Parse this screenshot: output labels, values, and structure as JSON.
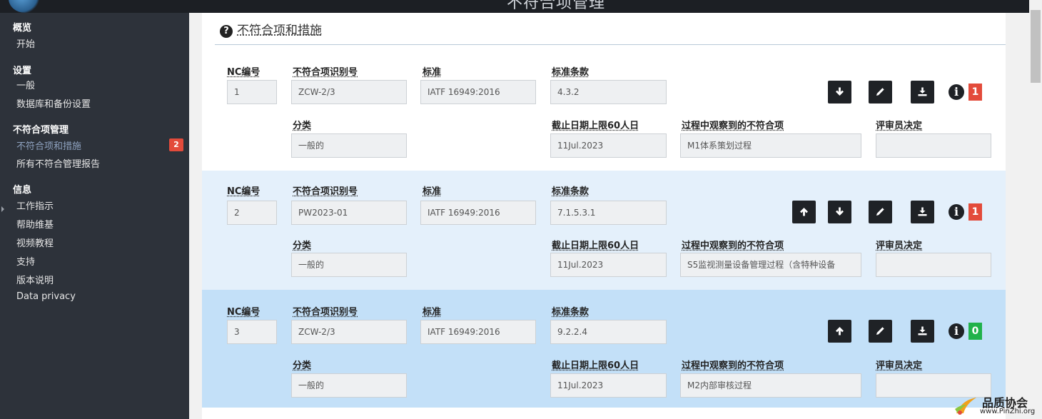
{
  "app": {
    "title": "不符合项管理"
  },
  "sidebar": {
    "groups": [
      {
        "label": "概览",
        "items": [
          "开始"
        ]
      },
      {
        "label": "设置",
        "items": [
          "一般",
          "数据库和备份设置"
        ]
      },
      {
        "label": "不符合项管理",
        "items": [
          "不符合项和措施",
          "所有不符合管理报告"
        ],
        "badge": "2"
      },
      {
        "label": "信息",
        "items": [
          "工作指示",
          "帮助维基",
          "视频教程",
          "支持",
          "版本说明",
          "Data privacy"
        ]
      }
    ]
  },
  "section": {
    "title": "不符合项和措施"
  },
  "labels": {
    "nc_no": "NC编号",
    "nc_id": "不符合项识别号",
    "standard": "标准",
    "clause": "标准条款",
    "category": "分类",
    "deadline": "截止日期上限60人日",
    "process": "过程中观察到的不符合项",
    "decision": "评审员决定"
  },
  "records": [
    {
      "nc_no": "1",
      "nc_id": "ZCW-2/3",
      "standard": "IATF 16949:2016",
      "clause": "4.3.2",
      "category": "一般的",
      "deadline": "11Jul.2023",
      "process": "M1体系策划过程",
      "decision": "",
      "count": "1",
      "count_color": "#e34b3b",
      "buttons": [
        "down-arrow-icon",
        "edit-icon",
        "download-icon"
      ]
    },
    {
      "nc_no": "2",
      "nc_id": "PW2023-01",
      "standard": "IATF 16949:2016",
      "clause": "7.1.5.3.1",
      "category": "一般的",
      "deadline": "11Jul.2023",
      "process": "S5监视测量设备管理过程（含特种设备",
      "decision": "",
      "count": "1",
      "count_color": "#e34b3b",
      "buttons": [
        "up-arrow-icon",
        "down-arrow-icon",
        "edit-icon",
        "download-icon"
      ]
    },
    {
      "nc_no": "3",
      "nc_id": "ZCW-2/3",
      "standard": "IATF 16949:2016",
      "clause": "9.2.2.4",
      "category": "一般的",
      "deadline": "11Jul.2023",
      "process": "M2内部审核过程",
      "decision": "",
      "count": "0",
      "count_color": "#21b24b",
      "buttons": [
        "up-arrow-icon",
        "edit-icon",
        "download-icon"
      ]
    }
  ],
  "watermark": {
    "name": "品质协会",
    "url": "www.PinZhi.org"
  }
}
